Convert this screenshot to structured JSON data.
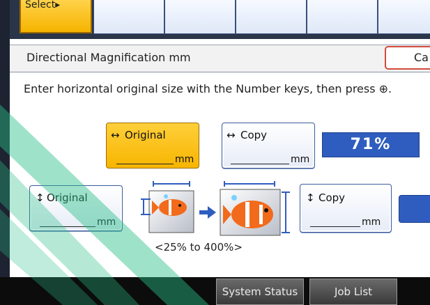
{
  "top_row": {
    "select_label": "Select▸"
  },
  "title_bar": {
    "title": "Directional Magnification mm",
    "cancel_label": "Ca"
  },
  "instruction": "Enter horizontal original size with the Number keys, then press ⊕.",
  "horizontal": {
    "original_arrow": "↔",
    "original_label": "Original",
    "original_unit": "mm",
    "copy_arrow": "↔",
    "copy_label": "Copy",
    "copy_unit": "mm"
  },
  "ratio": "71%",
  "vertical": {
    "original_arrow": "↕",
    "original_label": "Original",
    "original_unit": "mm",
    "copy_arrow": "↕",
    "copy_label": "Copy",
    "copy_unit": "mm"
  },
  "range_text": "<25% to 400%>",
  "bottom": {
    "system_status": "System Status",
    "job_list": "Job List"
  },
  "colors": {
    "selected_key": "#f7b500",
    "ratio_box": "#2f5dbf",
    "cancel_border": "#d24a3a",
    "watermark": "#2bbf8a"
  }
}
